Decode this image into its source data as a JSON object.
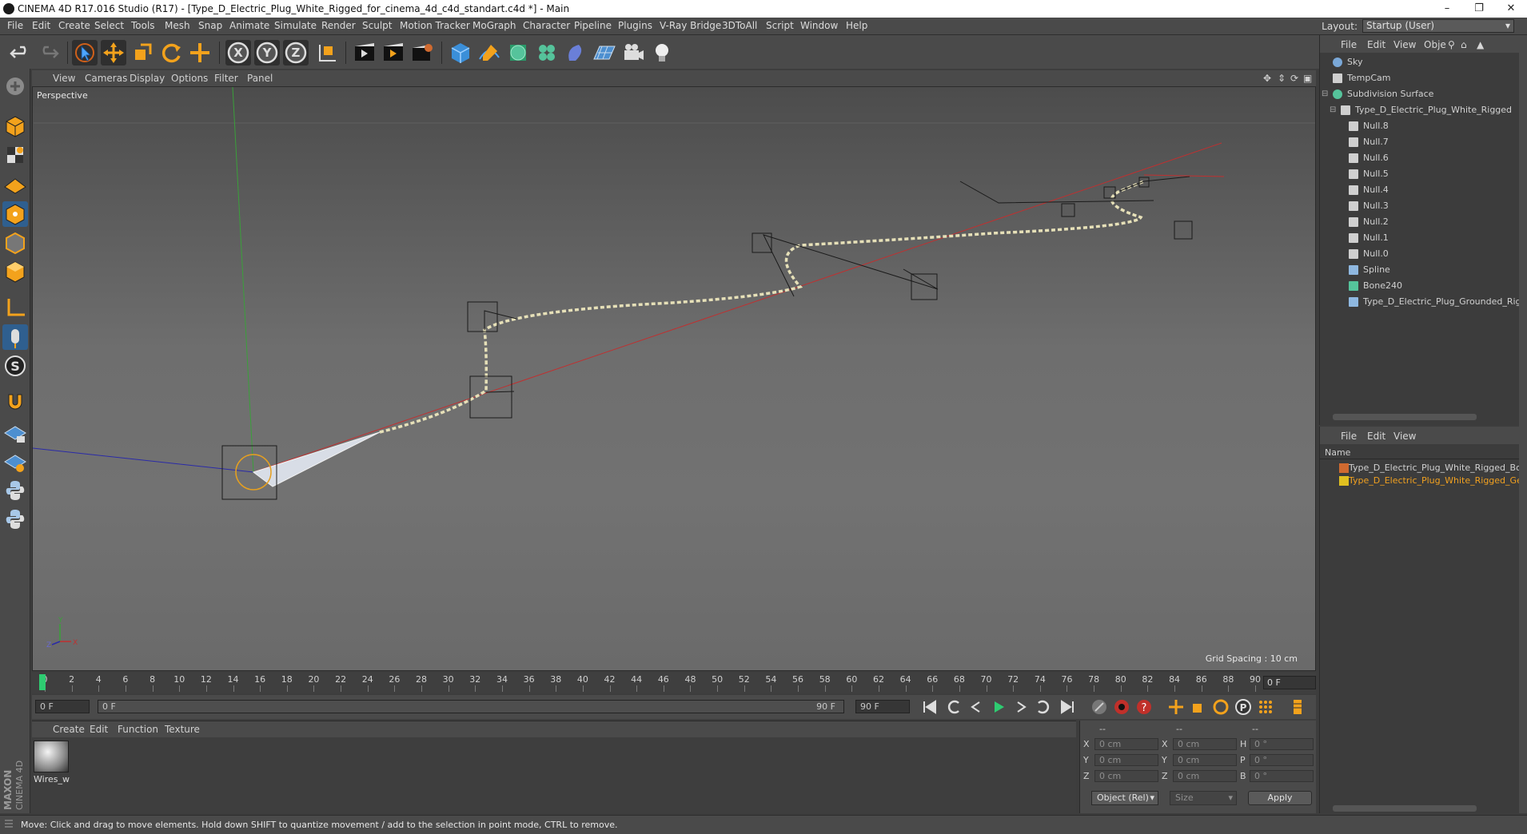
{
  "window": {
    "title": "CINEMA 4D R17.016 Studio (R17) - [Type_D_Electric_Plug_White_Rigged_for_cinema_4d_c4d_standart.c4d *] - Main",
    "minimize": "–",
    "maximize": "❐",
    "close": "✕"
  },
  "menubar": {
    "items": [
      "File",
      "Edit",
      "Create",
      "Select",
      "Tools",
      "Mesh",
      "Snap",
      "Animate",
      "Simulate",
      "Render",
      "Sculpt",
      "Motion Tracker",
      "MoGraph",
      "Character",
      "Pipeline",
      "Plugins",
      "V-Ray Bridge",
      "3DToAll",
      "Script",
      "Window",
      "Help"
    ],
    "layout_label": "Layout:",
    "layout_value": "Startup (User)"
  },
  "toolbar": {
    "icons": [
      "undo-icon",
      "redo-icon",
      "live-selection-icon",
      "move-icon",
      "scale-icon",
      "rotate-icon",
      "last-tool-icon",
      "x-axis-icon",
      "y-axis-icon",
      "z-axis-icon",
      "world-coord-icon",
      "render-view-icon",
      "render-picture-viewer-icon",
      "edit-render-settings-icon",
      "cube-icon",
      "pen-icon",
      "subdivision-icon",
      "cloner-icon",
      "deformer-icon",
      "floor-icon",
      "camera-icon",
      "light-icon"
    ],
    "axis_labels": [
      "X",
      "Y",
      "Z"
    ]
  },
  "left_tools": {
    "icons": [
      "make-editable-icon",
      "model-mode-icon",
      "texture-mode-icon",
      "workplane-mode-icon",
      "points-mode-icon",
      "edges-mode-icon",
      "polygons-mode-icon",
      "axis-mode-icon",
      "tweak-mode-icon",
      "soft-selection-icon",
      "magnet-icon",
      "locked-workplane-icon",
      "planar-workplane-icon",
      "python-icon",
      "python-generator-icon"
    ],
    "soft_label": "S"
  },
  "viewport": {
    "menu": [
      "View",
      "Cameras",
      "Display",
      "Options",
      "Filter",
      "Panel"
    ],
    "camera_label": "Perspective",
    "grid_spacing": "Grid Spacing : 10 cm",
    "axis_x": "X",
    "axis_y": "Y",
    "axis_z": "Z",
    "colors": {
      "x_axis": "#c03030",
      "y_axis": "#3aa03a",
      "z_axis": "#2a2aa8",
      "wire": "#e6e0b8",
      "handle": "#1a1a1a"
    }
  },
  "timeline": {
    "ticks": [
      "0",
      "2",
      "4",
      "6",
      "8",
      "10",
      "12",
      "14",
      "16",
      "18",
      "20",
      "22",
      "24",
      "26",
      "28",
      "30",
      "32",
      "34",
      "36",
      "38",
      "40",
      "42",
      "44",
      "46",
      "48",
      "50",
      "52",
      "54",
      "56",
      "58",
      "60",
      "62",
      "64",
      "66",
      "68",
      "70",
      "72",
      "74",
      "76",
      "78",
      "80",
      "82",
      "84",
      "86",
      "88",
      "90"
    ],
    "current_frame_field": "0 F"
  },
  "transport": {
    "start_field": "0 F",
    "range_start": "0 F",
    "range_end": "90 F",
    "end_field": "90 F",
    "icons": [
      "goto-start-icon",
      "play-reverse-loop-icon",
      "step-back-icon",
      "play-icon",
      "step-forward-icon",
      "loop-icon",
      "goto-end-icon",
      "record-motion-icon",
      "autokey-icon",
      "keyframe-help-icon",
      "move-key-icon",
      "scale-key-icon",
      "rotate-key-icon",
      "param-key-icon",
      "pla-key-icon",
      "timeline-icon"
    ]
  },
  "material": {
    "menu": [
      "Create",
      "Edit",
      "Function",
      "Texture"
    ],
    "items": [
      {
        "label": "Wires_w"
      }
    ]
  },
  "coordinates": {
    "headers": [
      "--",
      "--",
      "--"
    ],
    "rows": [
      {
        "axis": "X",
        "pos": "0 cm",
        "axis2": "X",
        "size": "0 cm",
        "rot_label": "H",
        "rot": "0 °"
      },
      {
        "axis": "Y",
        "pos": "0 cm",
        "axis2": "Y",
        "size": "0 cm",
        "rot_label": "P",
        "rot": "0 °"
      },
      {
        "axis": "Z",
        "pos": "0 cm",
        "axis2": "Z",
        "size": "0 cm",
        "rot_label": "B",
        "rot": "0 °"
      }
    ],
    "mode_select": "Object (Rel)",
    "size_select": "Size",
    "apply": "Apply"
  },
  "object_manager": {
    "menu": [
      "File",
      "Edit",
      "View",
      "Obje"
    ],
    "objects": [
      {
        "name": "Sky",
        "indent": 0,
        "icon": "sky-icon",
        "color": "#7aa8d8"
      },
      {
        "name": "TempCam",
        "indent": 0,
        "icon": "camera-icon",
        "color": "#cfcfcf"
      },
      {
        "name": "Subdivision Surface",
        "indent": 0,
        "icon": "subdivision-icon",
        "color": "#55c39b"
      },
      {
        "name": "Type_D_Electric_Plug_White_Rigged",
        "indent": 1,
        "icon": "null-icon",
        "color": "#cfcfcf"
      },
      {
        "name": "Null.8",
        "indent": 2,
        "icon": "null-icon",
        "color": "#cfcfcf"
      },
      {
        "name": "Null.7",
        "indent": 2,
        "icon": "null-icon",
        "color": "#cfcfcf"
      },
      {
        "name": "Null.6",
        "indent": 2,
        "icon": "null-icon",
        "color": "#cfcfcf"
      },
      {
        "name": "Null.5",
        "indent": 2,
        "icon": "null-icon",
        "color": "#cfcfcf"
      },
      {
        "name": "Null.4",
        "indent": 2,
        "icon": "null-icon",
        "color": "#cfcfcf"
      },
      {
        "name": "Null.3",
        "indent": 2,
        "icon": "null-icon",
        "color": "#cfcfcf"
      },
      {
        "name": "Null.2",
        "indent": 2,
        "icon": "null-icon",
        "color": "#cfcfcf"
      },
      {
        "name": "Null.1",
        "indent": 2,
        "icon": "null-icon",
        "color": "#cfcfcf"
      },
      {
        "name": "Null.0",
        "indent": 2,
        "icon": "null-icon",
        "color": "#cfcfcf"
      },
      {
        "name": "Spline",
        "indent": 2,
        "icon": "spline-icon",
        "color": "#8fb8e0"
      },
      {
        "name": "Bone240",
        "indent": 2,
        "icon": "bone-icon",
        "color": "#55c39b"
      },
      {
        "name": "Type_D_Electric_Plug_Grounded_Rig",
        "indent": 2,
        "icon": "joint-icon",
        "color": "#8fb8e0"
      }
    ]
  },
  "attribute_manager": {
    "menu": [
      "File",
      "Edit",
      "View"
    ],
    "column": "Name",
    "items": [
      {
        "name": "Type_D_Electric_Plug_White_Rigged_Bo",
        "color": "#d06a30",
        "text_color": "#d0d0d0"
      },
      {
        "name": "Type_D_Electric_Plug_White_Rigged_Ge",
        "color": "#e0c020",
        "text_color": "#f0a020"
      }
    ]
  },
  "status": {
    "text": "Move: Click and drag to move elements. Hold down SHIFT to quantize movement / add to the selection in point mode, CTRL to remove."
  },
  "branding": {
    "logo": "MAXON CINEMA 4D"
  }
}
